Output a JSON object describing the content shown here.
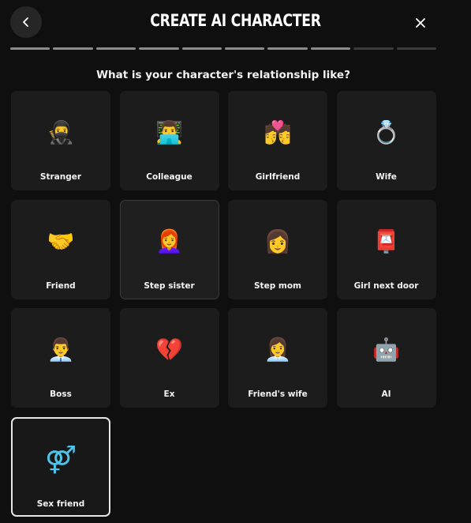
{
  "header": {
    "title": "CREATE AI CHARACTER"
  },
  "progress": {
    "total_steps": 10,
    "completed_steps": 8,
    "active_color": "#8c8c8c",
    "inactive_color": "#3a3a3a"
  },
  "question": "What is your character's relationship like?",
  "options": [
    {
      "label": "Stranger",
      "emoji": "🥷",
      "state": "default"
    },
    {
      "label": "Colleague",
      "emoji": "👨‍💻",
      "state": "default"
    },
    {
      "label": "Girlfriend",
      "emoji": "💏",
      "state": "default"
    },
    {
      "label": "Wife",
      "emoji": "💍",
      "state": "default"
    },
    {
      "label": "Friend",
      "emoji": "🤝",
      "state": "default"
    },
    {
      "label": "Step sister",
      "emoji": "👩‍🦰",
      "state": "hover"
    },
    {
      "label": "Step mom",
      "emoji": "👩",
      "state": "default"
    },
    {
      "label": "Girl next door",
      "emoji": "📮",
      "state": "default"
    },
    {
      "label": "Boss",
      "emoji": "👨‍💼",
      "state": "default"
    },
    {
      "label": "Ex",
      "emoji": "💔",
      "state": "default"
    },
    {
      "label": "Friend's wife",
      "emoji": "👩‍💼",
      "state": "default"
    },
    {
      "label": "AI",
      "emoji": "🤖",
      "state": "default"
    },
    {
      "label": "Sex friend",
      "emoji": "⚤",
      "state": "selected"
    }
  ],
  "icons": {
    "back": "chevron-left-icon",
    "close": "close-icon"
  }
}
